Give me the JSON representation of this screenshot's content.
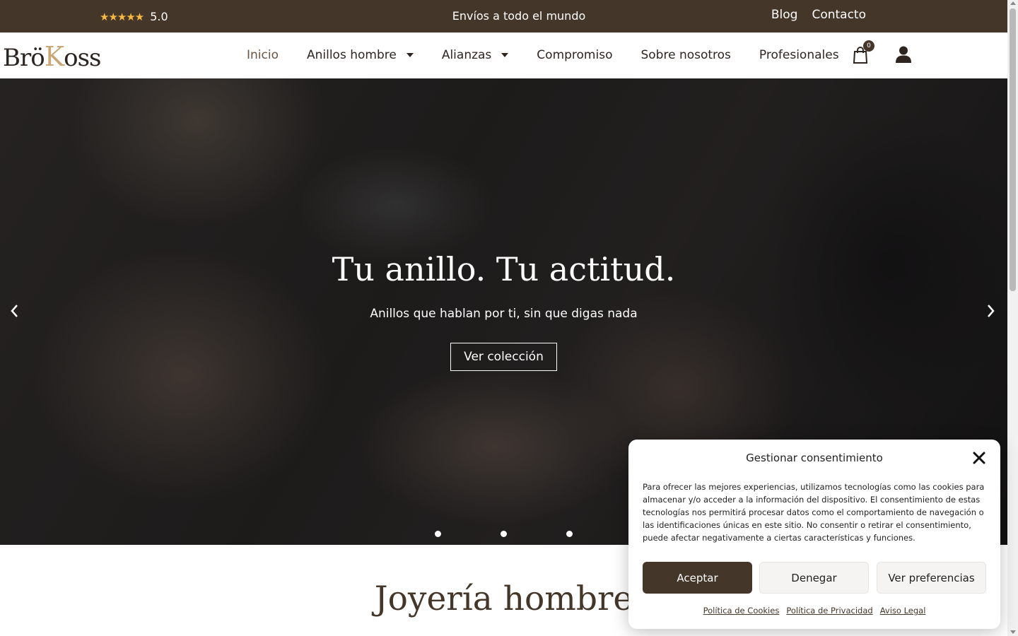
{
  "topbar": {
    "rating_stars": "★★★★★",
    "rating_value": "5.0",
    "shipping_text": "Envíos a todo el mundo",
    "links": [
      {
        "label": "Blog"
      },
      {
        "label": "Contacto"
      }
    ],
    "background_color": "#45362a",
    "star_color": "#f5b942"
  },
  "header": {
    "logo": {
      "part1": "Brö",
      "part2": "K",
      "part3": "oss"
    },
    "nav": [
      {
        "label": "Inicio",
        "active": true
      },
      {
        "label": "Anillos hombre",
        "dropdown": true
      },
      {
        "label": "Alianzas",
        "dropdown": true
      },
      {
        "label": "Compromiso"
      },
      {
        "label": "Sobre nosotros"
      },
      {
        "label": "Profesionales"
      }
    ],
    "cart_count": "0",
    "icons": [
      "shopping-bag-icon",
      "user-icon"
    ]
  },
  "hero": {
    "title": "Tu anillo. Tu actitud.",
    "subtitle": "Anillos que hablan por ti, sin que digas nada",
    "button_label": "Ver colección",
    "prev_arrow": "‹",
    "next_arrow": "›",
    "slides": 3
  },
  "section": {
    "title": "Joyería hombre"
  },
  "consent": {
    "title": "Gestionar consentimiento",
    "text": "Para ofrecer las mejores experiencias, utilizamos tecnologías como las cookies para almacenar y/o acceder a la información del dispositivo. El consentimiento de estas tecnologías nos permitirá procesar datos como el comportamiento de navegación o las identificaciones únicas en este sitio. No consentir o retirar el consentimiento, puede afectar negativamente a ciertas características y funciones.",
    "accept_label": "Aceptar",
    "deny_label": "Denegar",
    "preferences_label": "Ver preferencias",
    "links": [
      {
        "label": "Política de Cookies"
      },
      {
        "label": "Política de Privacidad"
      },
      {
        "label": "Aviso Legal"
      }
    ],
    "accent_color": "#45362a"
  }
}
